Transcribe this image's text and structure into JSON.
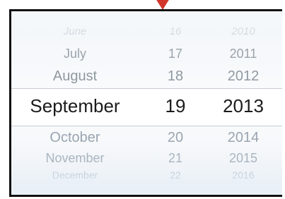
{
  "picker": {
    "rows": [
      {
        "month": "June",
        "day": "16",
        "year": "2010"
      },
      {
        "month": "July",
        "day": "17",
        "year": "2011"
      },
      {
        "month": "August",
        "day": "18",
        "year": "2012"
      },
      {
        "month": "September",
        "day": "19",
        "year": "2013"
      },
      {
        "month": "October",
        "day": "20",
        "year": "2014"
      },
      {
        "month": "November",
        "day": "21",
        "year": "2015"
      },
      {
        "month": "December",
        "day": "22",
        "year": "2016"
      }
    ]
  }
}
